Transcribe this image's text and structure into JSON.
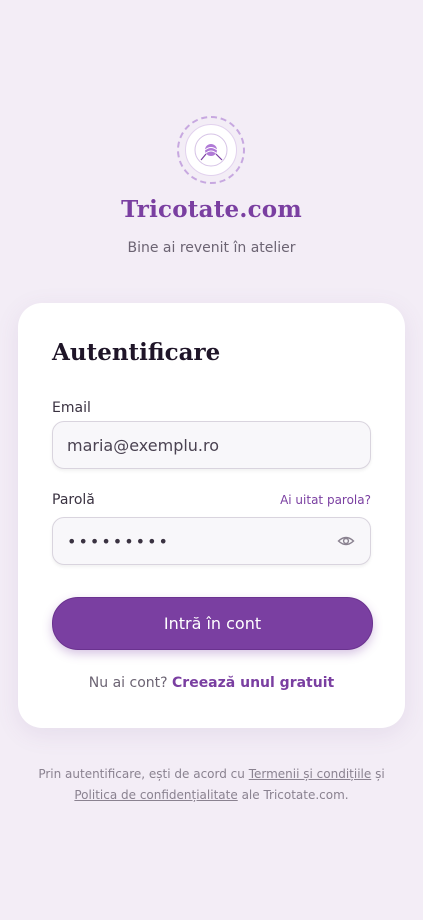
{
  "header": {
    "logo_text": "TRICOTATE.COM",
    "brand": "Tricotate.com",
    "tagline": "Bine ai revenit în atelier"
  },
  "login": {
    "title": "Autentificare",
    "email_label": "Email",
    "email_value": "maria@exemplu.ro",
    "password_label": "Parolă",
    "forgot_link": "Ai uitat parola?",
    "password_value": "•••••••••",
    "submit_label": "Intră în cont",
    "signup_prompt": "Nu ai cont?",
    "signup_link": "Creează unul gratuit"
  },
  "legal": {
    "prefix": "Prin autentificare, ești de acord cu",
    "terms_link": "Termenii și condițiile",
    "and": "și",
    "privacy_link": "Politica de confidențialitate",
    "suffix": "ale Tricotate.com."
  },
  "icons": {
    "logo": "yarn-ball-icon",
    "password_toggle": "eye-icon"
  },
  "colors": {
    "brand": "#7a3fa1",
    "background": "#f3edf6"
  }
}
